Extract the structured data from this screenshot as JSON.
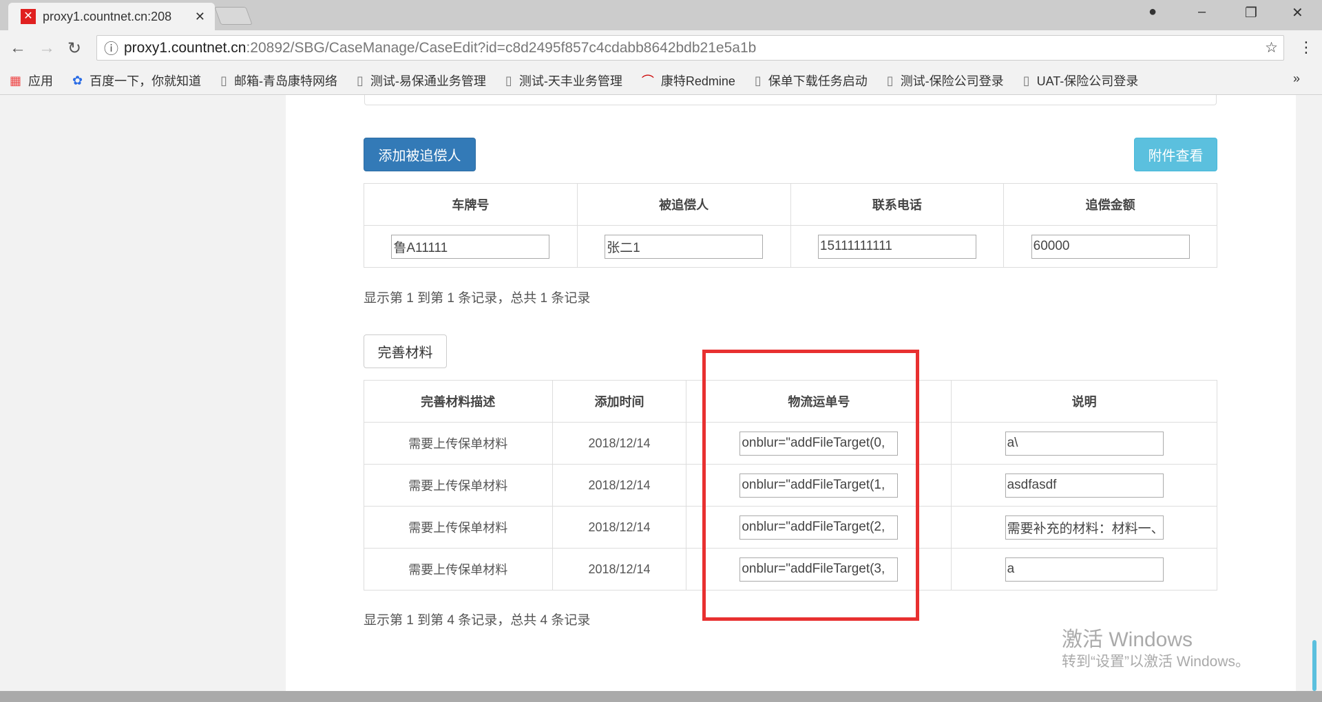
{
  "browser": {
    "tab_title": "proxy1.countnet.cn:208",
    "url_host": "proxy1.countnet.cn",
    "url_path": ":20892/SBG/CaseManage/CaseEdit?id=c8d2495f857c4cdabb8642bdb21e5a1b",
    "bookmarks": [
      "应用",
      "百度一下，你就知道",
      "邮箱-青岛康特网络",
      "测试-易保通业务管理",
      "测试-天丰业务管理",
      "康特Redmine",
      "保单下载任务启动",
      "测试-保险公司登录",
      "UAT-保险公司登录"
    ],
    "more": "»"
  },
  "actions": {
    "add_label": "添加被追偿人",
    "attach_label": "附件查看",
    "materials_label": "完善材料"
  },
  "table1": {
    "headers": [
      "车牌号",
      "被追偿人",
      "联系电话",
      "追偿金额"
    ],
    "row": [
      "鲁A11111",
      "张二1",
      "15111111111",
      "60000"
    ],
    "info": "显示第 1 到第 1 条记录，总共 1 条记录"
  },
  "table2": {
    "headers": [
      "完善材料描述",
      "添加时间",
      "物流运单号",
      "说明"
    ],
    "rows": [
      {
        "desc": "需要上传保单材料",
        "time": "2018/12/14",
        "tracking": "onblur=\"addFileTarget(0,",
        "note": "a\\"
      },
      {
        "desc": "需要上传保单材料",
        "time": "2018/12/14",
        "tracking": "onblur=\"addFileTarget(1,",
        "note": "asdfasdf"
      },
      {
        "desc": "需要上传保单材料",
        "time": "2018/12/14",
        "tracking": "onblur=\"addFileTarget(2,",
        "note": "需要补充的材料：材料一、"
      },
      {
        "desc": "需要上传保单材料",
        "time": "2018/12/14",
        "tracking": "onblur=\"addFileTarget(3,",
        "note": "a"
      }
    ],
    "info": "显示第 1 到第 4 条记录，总共 4 条记录"
  },
  "watermark": {
    "line1": "激活 Windows",
    "line2": "转到“设置”以激活 Windows。"
  }
}
